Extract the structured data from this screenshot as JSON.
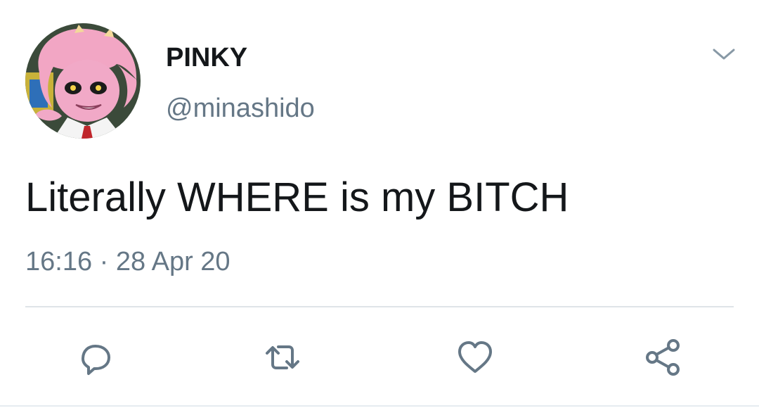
{
  "tweet": {
    "author": {
      "display_name": "PINKY",
      "handle": "@minashido",
      "avatar": "pink-haired-anime-character-avatar"
    },
    "text": "Literally WHERE is my BITCH",
    "time": "16:16",
    "separator": "·",
    "date": "28 Apr 20"
  },
  "actions": [
    {
      "icon": "reply-icon"
    },
    {
      "icon": "retweet-icon"
    },
    {
      "icon": "like-icon"
    },
    {
      "icon": "share-icon"
    }
  ],
  "menu": {
    "icon": "chevron-down-icon"
  },
  "colors": {
    "primary_text": "#14171a",
    "secondary_text": "#657786",
    "icon": "#657786",
    "divider": "#dfe4e8"
  }
}
